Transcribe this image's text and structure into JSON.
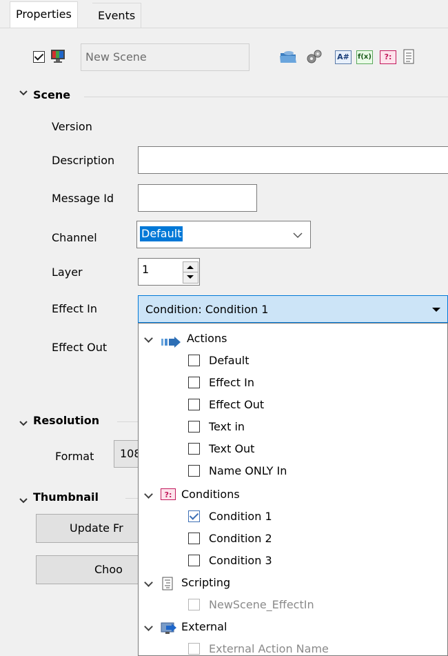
{
  "tabs": [
    {
      "label": "Properties",
      "active": true
    },
    {
      "label": "Events",
      "active": false
    }
  ],
  "header": {
    "enabled_checked": true,
    "scene_name": "New Scene",
    "toolbar_icons": [
      "folder-icon",
      "gears-icon",
      "text-var-icon",
      "function-icon",
      "condition-icon",
      "script-icon"
    ],
    "text_var_glyph": "A#",
    "function_glyph": "f(x)",
    "condition_glyph": "?:"
  },
  "scene_section": {
    "title": "Scene",
    "version_label": "Version",
    "description_label": "Description",
    "description_value": "",
    "message_id_label": "Message Id",
    "message_id_value": "",
    "channel_label": "Channel",
    "channel_value": "Default",
    "layer_label": "Layer",
    "layer_value": "1",
    "effect_in_label": "Effect In",
    "effect_in_value": "Condition: Condition 1",
    "effect_out_label": "Effect Out"
  },
  "resolution_section": {
    "title": "Resolution",
    "format_label": "Format",
    "format_value": "108"
  },
  "thumbnail_section": {
    "title": "Thumbnail",
    "update_button": "Update Fr",
    "choose_button": "Choo"
  },
  "dropdown": {
    "groups": [
      {
        "label": "Actions",
        "icon": "arrow-right-icon",
        "items": [
          {
            "label": "Default",
            "checked": false
          },
          {
            "label": "Effect In",
            "checked": false
          },
          {
            "label": "Effect Out",
            "checked": false
          },
          {
            "label": "Text in",
            "checked": false
          },
          {
            "label": "Text Out",
            "checked": false
          },
          {
            "label": "Name ONLY In",
            "checked": false
          }
        ]
      },
      {
        "label": "Conditions",
        "icon": "condition-icon",
        "items": [
          {
            "label": "Condition 1",
            "checked": true
          },
          {
            "label": "Condition 2",
            "checked": false
          },
          {
            "label": "Condition 3",
            "checked": false
          }
        ]
      },
      {
        "label": "Scripting",
        "icon": "script-icon",
        "items": [
          {
            "label": "NewScene_EffectIn",
            "checked": false,
            "disabled": true
          }
        ]
      },
      {
        "label": "External",
        "icon": "external-icon",
        "items": [
          {
            "label": "External Action Name",
            "checked": false,
            "disabled": true
          }
        ]
      }
    ]
  },
  "colors": {
    "accent": "#0078d7",
    "selection_bg": "#cce4f7",
    "condition_icon": "#c2185b"
  }
}
